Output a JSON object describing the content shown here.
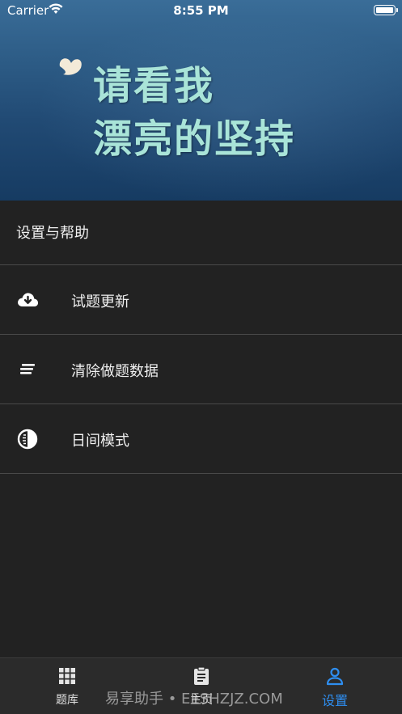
{
  "status_bar": {
    "carrier": "Carrier",
    "time": "8:55 PM"
  },
  "banner": {
    "line1": "请看我",
    "line2": "漂亮的坚持",
    "text_color": "#a9e4d8"
  },
  "settings": {
    "section_title": "设置与帮助",
    "items": [
      {
        "label": "试题更新",
        "icon": "cloud-download-icon"
      },
      {
        "label": "清除做题数据",
        "icon": "lines-icon"
      },
      {
        "label": "日间模式",
        "icon": "contrast-icon"
      }
    ]
  },
  "tab_bar": {
    "tabs": [
      {
        "label": "题库",
        "icon": "grid-icon",
        "active": false
      },
      {
        "label": "主页",
        "icon": "clipboard-icon",
        "active": false
      },
      {
        "label": "设置",
        "icon": "person-icon",
        "active": true
      }
    ],
    "active_color": "#2e8ef0"
  },
  "watermark": "易享助手 • EESHZJZ.COM"
}
